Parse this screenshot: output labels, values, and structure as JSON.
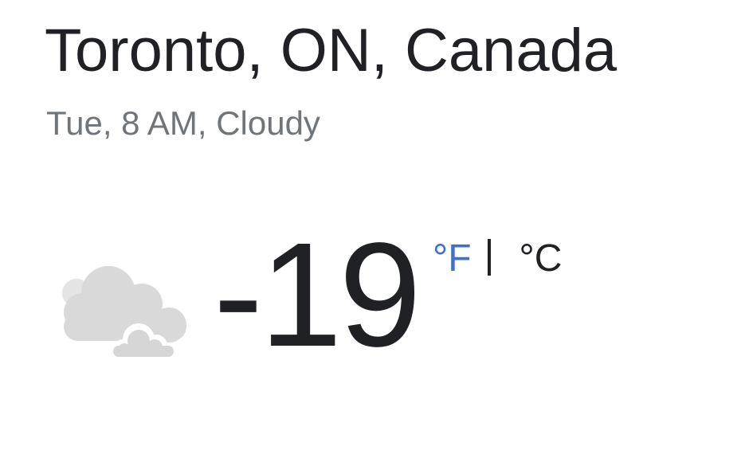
{
  "location": "Toronto, ON, Canada",
  "subtitle": "Tue, 8 AM, Cloudy",
  "weather": {
    "condition_icon": "cloudy-icon",
    "temperature": "-19",
    "unit_fahrenheit": "°F",
    "unit_separator": "|",
    "unit_celsius": "°C",
    "active_unit": "F",
    "colors": {
      "active_unit": "#4470c4",
      "cloud": "#dadada",
      "text": "#202124",
      "subtitle": "#70757a"
    }
  }
}
